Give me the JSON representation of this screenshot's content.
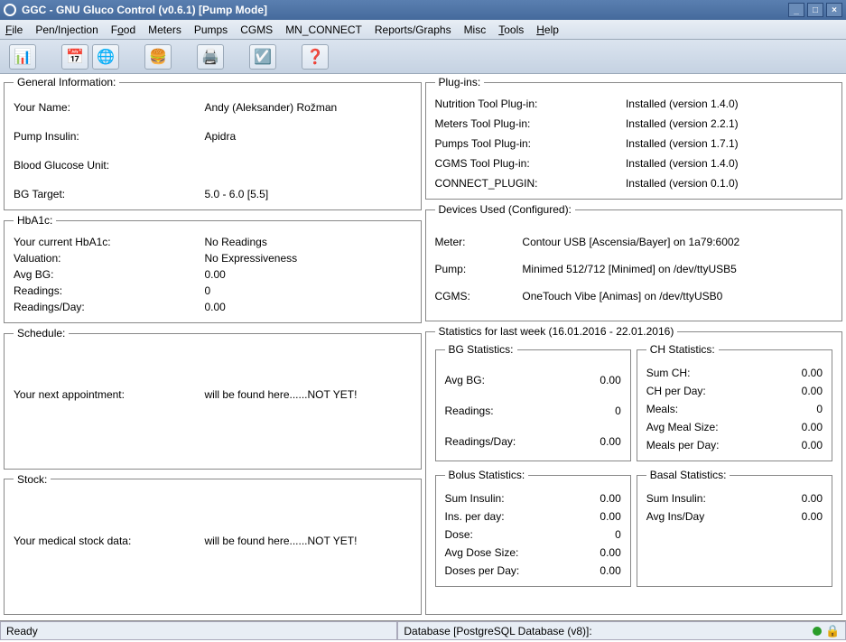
{
  "window": {
    "title": "GGC - GNU Gluco Control (v0.6.1) [Pump Mode]"
  },
  "menu": {
    "file": "File",
    "pen": "Pen/Injection",
    "food": "Food",
    "meters": "Meters",
    "pumps": "Pumps",
    "cgms": "CGMS",
    "mnconnect": "MN_CONNECT",
    "reports": "Reports/Graphs",
    "misc": "Misc",
    "tools": "Tools",
    "help": "Help"
  },
  "general": {
    "legend": "General Information:",
    "name_lbl": "Your Name:",
    "name_val": "Andy (Aleksander) Rožman",
    "insulin_lbl": "Pump Insulin:",
    "insulin_val": "Apidra",
    "bgu_lbl": "Blood Glucose Unit:",
    "bgu_val": "",
    "target_lbl": "BG Target:",
    "target_val": "5.0 - 6.0 [5.5]"
  },
  "hba1c": {
    "legend": "HbA1c:",
    "curr_lbl": "Your current HbA1c:",
    "curr_val": "No Readings",
    "valuation_lbl": "Valuation:",
    "valuation_val": "No Expressiveness",
    "avg_lbl": "Avg BG:",
    "avg_val": "0.00",
    "readings_lbl": "Readings:",
    "readings_val": "0",
    "perday_lbl": "Readings/Day:",
    "perday_val": "0.00"
  },
  "schedule": {
    "legend": "Schedule:",
    "appt_lbl": "Your next appointment:",
    "appt_val": "will be found here......NOT YET!"
  },
  "stock": {
    "legend": "Stock:",
    "lbl": "Your medical stock data:",
    "val": "will be found here......NOT YET!"
  },
  "plugins": {
    "legend": "Plug-ins:",
    "rows": [
      {
        "name": "Nutrition Tool Plug-in:",
        "status": "Installed (version 1.4.0)"
      },
      {
        "name": "Meters Tool Plug-in:",
        "status": "Installed (version 2.2.1)"
      },
      {
        "name": "Pumps Tool Plug-in:",
        "status": "Installed (version 1.7.1)"
      },
      {
        "name": "CGMS Tool Plug-in:",
        "status": "Installed (version 1.4.0)"
      },
      {
        "name": "CONNECT_PLUGIN:",
        "status": "Installed (version 0.1.0)"
      }
    ]
  },
  "devices": {
    "legend": "Devices Used (Configured):",
    "meter_lbl": "Meter:",
    "meter_val": "Contour USB [Ascensia/Bayer] on 1a79:6002",
    "pump_lbl": "Pump:",
    "pump_val": "Minimed 512/712 [Minimed] on /dev/ttyUSB5",
    "cgms_lbl": "CGMS:",
    "cgms_val": "OneTouch Vibe [Animas] on /dev/ttyUSB0"
  },
  "stats": {
    "legend": "Statistics for last week (16.01.2016 - 22.01.2016)",
    "bg": {
      "legend": "BG Statistics:",
      "avg_lbl": "Avg BG:",
      "avg_val": "0.00",
      "readings_lbl": "Readings:",
      "readings_val": "0",
      "perday_lbl": "Readings/Day:",
      "perday_val": "0.00"
    },
    "ch": {
      "legend": "CH Statistics:",
      "sum_lbl": "Sum CH:",
      "sum_val": "0.00",
      "perday_lbl": "CH per Day:",
      "perday_val": "0.00",
      "meals_lbl": "Meals:",
      "meals_val": "0",
      "mealsize_lbl": "Avg Meal Size:",
      "mealsize_val": "0.00",
      "mealsday_lbl": "Meals per Day:",
      "mealsday_val": "0.00"
    },
    "bolus": {
      "legend": "Bolus Statistics:",
      "sum_lbl": "Sum Insulin:",
      "sum_val": "0.00",
      "perday_lbl": "Ins. per day:",
      "perday_val": "0.00",
      "dose_lbl": "Dose:",
      "dose_val": "0",
      "dosesize_lbl": "Avg Dose Size:",
      "dosesize_val": "0.00",
      "dosesday_lbl": "Doses per Day:",
      "dosesday_val": "0.00"
    },
    "basal": {
      "legend": "Basal Statistics:",
      "sum_lbl": "Sum Insulin:",
      "sum_val": "0.00",
      "avg_lbl": "Avg Ins/Day",
      "avg_val": "0.00"
    }
  },
  "status": {
    "left": "Ready",
    "right": "Database [PostgreSQL Database (v8)]:"
  }
}
